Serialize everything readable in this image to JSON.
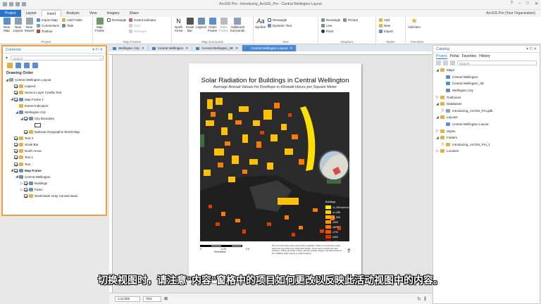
{
  "window": {
    "title": "ArcGIS Pro - Introducing_ArcGIS_Pro - Central Wellington Layout"
  },
  "ribbon_tabs": [
    {
      "label": "Project"
    },
    {
      "label": "Layout"
    },
    {
      "label": "Insert"
    },
    {
      "label": "Analysis"
    },
    {
      "label": "View"
    },
    {
      "label": "Imagery"
    },
    {
      "label": "Share"
    }
  ],
  "user": "ArcGIS Pro (Your Organization)",
  "ribbon": {
    "project": {
      "label": "Project",
      "new_map": "New Map",
      "new_layout": "New Layout",
      "new_report": "New Report",
      "import_map": "Import Map",
      "add_folder": "Add Folder",
      "connections": "Connections",
      "task": "Task",
      "toolbox": "Toolbox"
    },
    "map_frames": {
      "label": "Map Frames",
      "map_frame": "Map Frame",
      "rectangle": "Rectangle",
      "extent_indicator": "Extent Indicator",
      "grid": "Grid",
      "reshape": "Reshape"
    },
    "map_surrounds": {
      "label": "Map Surrounds",
      "north_arrow": "North Arrow",
      "scale_bar": "Scale Bar",
      "legend": "Legend",
      "chart_frame": "Chart Frame",
      "table_frame": "Table Frame",
      "additional_surrounds": "Additional Surrounds"
    },
    "text": {
      "label": "Text",
      "symbol": "Symbol",
      "rectangle": "Rectangle",
      "dynamic_text": "Dynamic Text"
    },
    "graphics": {
      "label": "Graphics",
      "rectangle": "Rectangle",
      "line": "Line",
      "point": "Point",
      "picture": "Picture"
    },
    "styles": {
      "label": "Styles",
      "add": "Add",
      "new": "New",
      "import": "Import"
    },
    "favorites": {
      "label": "Favorites",
      "add_item": "Add Item"
    }
  },
  "contents": {
    "title": "Contents",
    "search_placeholder": "Search",
    "section": "Drawing Order",
    "items": [
      {
        "label": "Central Wellington Layout",
        "level": 0,
        "checkbox": false,
        "arrow": "◢"
      },
      {
        "label": "Legend",
        "level": 1,
        "checkbox": true,
        "arrow": ""
      },
      {
        "label": "Service Layer Credits Text",
        "level": 1,
        "checkbox": true,
        "arrow": ""
      },
      {
        "label": "Map Frame 1",
        "level": 1,
        "checkbox": true,
        "arrow": "◢"
      },
      {
        "label": "Extent Indicators",
        "level": 2,
        "checkbox": false,
        "arrow": ""
      },
      {
        "label": "Wellington City",
        "level": 2,
        "checkbox": false,
        "arrow": "◢"
      },
      {
        "label": "City Boundary",
        "level": 3,
        "checkbox": true,
        "arrow": "◢"
      },
      {
        "label": "",
        "level": 4,
        "checkbox": false,
        "arrow": "",
        "symbol": true
      },
      {
        "label": "National Geographic World Map",
        "level": 3,
        "checkbox": true,
        "arrow": ""
      },
      {
        "label": "Text 3",
        "level": 1,
        "checkbox": true,
        "arrow": ""
      },
      {
        "label": "Scale Bar",
        "level": 1,
        "checkbox": true,
        "arrow": ""
      },
      {
        "label": "North Arrow",
        "level": 1,
        "checkbox": true,
        "arrow": ""
      },
      {
        "label": "Text 1",
        "level": 1,
        "checkbox": true,
        "arrow": ""
      },
      {
        "label": "Text",
        "level": 1,
        "checkbox": true,
        "arrow": ""
      },
      {
        "label": "Map Frame",
        "level": 1,
        "checkbox": true,
        "arrow": "◢",
        "bold": true
      },
      {
        "label": "Central Wellington",
        "level": 2,
        "checkbox": false,
        "arrow": "◢"
      },
      {
        "label": "Buildings",
        "level": 3,
        "checkbox": true,
        "arrow": "▷"
      },
      {
        "label": "Parks",
        "level": 3,
        "checkbox": true,
        "arrow": "▷"
      },
      {
        "label": "World Dark Gray Canvas Base",
        "level": 3,
        "checkbox": true,
        "arrow": ""
      }
    ]
  },
  "doc_tabs": [
    {
      "label": "Wellington City",
      "active": false
    },
    {
      "label": "Central Wellington",
      "active": false
    },
    {
      "label": "Central Wellington_3D",
      "active": false
    },
    {
      "label": "Central Wellington Layout",
      "active": true
    }
  ],
  "layout": {
    "title": "Solar Radiation for Buildings in Central Wellington",
    "subtitle": "Average Annual Values for Rooftops in Kilowatt Hours per Square Meter",
    "legend": {
      "title": "Buildings",
      "items": [
        {
          "label": "≤1,296 kwh/m2",
          "color": "#ffee00"
        },
        {
          "label": "≤1,188",
          "color": "#ffd000"
        },
        {
          "label": "≤1,008",
          "color": "#ffb000"
        },
        {
          "label": "≤900",
          "color": "#ff9000"
        },
        {
          "label": "≤800",
          "color": "#ff7000"
        },
        {
          "label": "≤700",
          "color": "#f05000"
        },
        {
          "label": "≤600",
          "color": "#d83000"
        },
        {
          "label": "≤500",
          "color": "#b01000"
        }
      ],
      "parks_label": "Parks",
      "parks_color": "#3a6e3a"
    },
    "scale": {
      "ticks": [
        "0",
        "0.25",
        "0.5"
      ],
      "unit": "Kilometers"
    },
    "credits": "3D roof information was used where available. Older roof structures were assumed to be flat at an estimated height. Trees were omitted from the analysis. Yellow and light orange colours indicate higher potential locations for installing solar panels or water heating."
  },
  "status": {
    "scale": "1:11,000",
    "zoom": "75%"
  },
  "catalog": {
    "title": "Catalog",
    "tabs": [
      {
        "label": "Project",
        "active": true
      },
      {
        "label": "Portal",
        "active": false
      },
      {
        "label": "Favorites",
        "active": false
      },
      {
        "label": "History",
        "active": false
      }
    ],
    "search_placeholder": "Search",
    "items": [
      {
        "label": "Maps",
        "level": 0,
        "arrow": "◢",
        "color": "#e4b040"
      },
      {
        "label": "Central Wellington",
        "level": 1,
        "arrow": "",
        "color": "#5b8fd1"
      },
      {
        "label": "Central Wellington_3D",
        "level": 1,
        "arrow": "",
        "color": "#5b8fd1"
      },
      {
        "label": "Wellington City",
        "level": 1,
        "arrow": "",
        "color": "#5b8fd1"
      },
      {
        "label": "Toolboxes",
        "level": 0,
        "arrow": "▷",
        "color": "#e4b040"
      },
      {
        "label": "Databases",
        "level": 0,
        "arrow": "◢",
        "color": "#e4b040"
      },
      {
        "label": "Introducing_ArcGIS_Pro.gdb",
        "level": 1,
        "arrow": "▷",
        "color": "#8aa0b8"
      },
      {
        "label": "Layouts",
        "level": 0,
        "arrow": "◢",
        "color": "#e4b040"
      },
      {
        "label": "Central Wellington Layout",
        "level": 1,
        "arrow": "",
        "color": "#5b8fd1"
      },
      {
        "label": "Styles",
        "level": 0,
        "arrow": "▷",
        "color": "#e4b040"
      },
      {
        "label": "Folders",
        "level": 0,
        "arrow": "◢",
        "color": "#e4b040"
      },
      {
        "label": "Introducing_ArcGIS_Pro_1",
        "level": 1,
        "arrow": "▷",
        "color": "#e4b040"
      },
      {
        "label": "Locators",
        "level": 0,
        "arrow": "▷",
        "color": "#e4b040"
      }
    ]
  },
  "subtitle_text": "切换视图时，请注意“内容”窗格中的项目如何更改以反映此活动视图中的内容。"
}
